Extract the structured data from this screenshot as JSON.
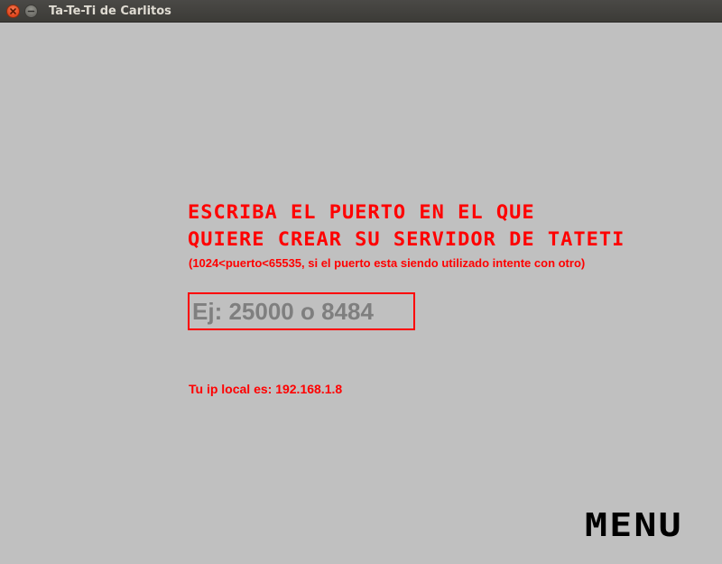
{
  "window": {
    "title": "Ta-Te-Ti de Carlitos",
    "buttons": {
      "close_icon": "close-icon",
      "minimize_icon": "minimize-icon"
    }
  },
  "main": {
    "heading_line_1": "ESCRIBA EL PUERTO EN EL QUE",
    "heading_line_2": "QUIERE CREAR SU SERVIDOR DE TATETI",
    "hint": "(1024<puerto<65535, si el puerto esta siendo utilizado intente con otro)",
    "port_input": {
      "value": "",
      "placeholder": "Ej: 25000 o 8484"
    },
    "local_ip_text": "Tu ip local es: 192.168.1.8",
    "menu_button_label": "MENU"
  },
  "colors": {
    "background": "#c0c0c0",
    "accent_red": "#ff0000",
    "placeholder_gray": "#7f7f7f",
    "menu_black": "#000000"
  }
}
